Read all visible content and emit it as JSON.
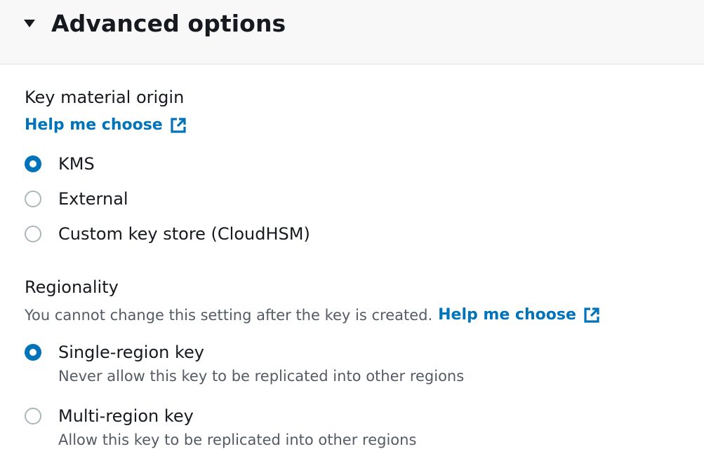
{
  "header": {
    "title": "Advanced options",
    "toggle_icon": "caret-down-icon"
  },
  "key_material": {
    "label": "Key material origin",
    "help_link": "Help me choose",
    "help_icon": "external-link-icon",
    "options": [
      {
        "label": "KMS",
        "checked": true
      },
      {
        "label": "External",
        "checked": false
      },
      {
        "label": "Custom key store (CloudHSM)",
        "checked": false
      }
    ]
  },
  "regionality": {
    "label": "Regionality",
    "description": "You cannot change this setting after the key is created.",
    "help_link": "Help me choose",
    "help_icon": "external-link-icon",
    "options": [
      {
        "label": "Single-region key",
        "description": "Never allow this key to be replicated into other regions",
        "checked": true
      },
      {
        "label": "Multi-region key",
        "description": "Allow this key to be replicated into other regions",
        "checked": false
      }
    ]
  },
  "colors": {
    "accent": "#0073bb",
    "text": "#16191f",
    "secondary_text": "#545b64",
    "header_bg": "#f8f8f8"
  }
}
